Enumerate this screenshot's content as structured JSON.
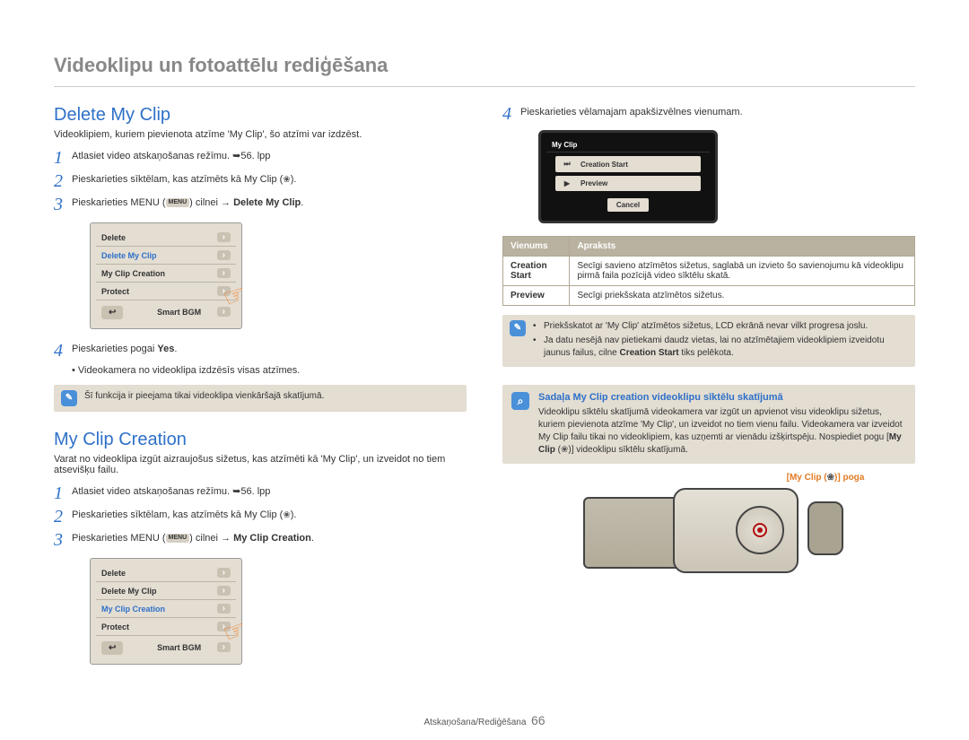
{
  "page_title": "Videoklipu un fotoattēlu rediģēšana",
  "footer": {
    "section": "Atskaņošana/Rediģēšana",
    "page": "66"
  },
  "left": {
    "delete": {
      "heading": "Delete My Clip",
      "intro": "Videoklipiem, kuriem pievienota atzīme 'My Clip', šo atzīmi var izdzēst.",
      "steps": {
        "s1": "Atlasiet video atskaņošanas režīmu. ➥56. lpp",
        "s2": "Pieskarieties sīktēlam, kas atzīmēts kā My Clip (",
        "s2_end": ").",
        "s3a": "Pieskarieties MENU (",
        "s3b": ") cilnei → ",
        "s3c": "Delete My Clip",
        "s3d": ".",
        "s4a": "Pieskarieties pogai ",
        "s4b": "Yes",
        "s4sub": "Videokamera no videoklipa izdzēsīs visas atzīmes."
      },
      "menu": {
        "items": [
          "Delete",
          "Delete My Clip",
          "My Clip Creation",
          "Protect",
          "Smart BGM"
        ],
        "highlight_index": 1
      },
      "info": "Šī funkcija ir pieejama tikai videoklipa vienkāršajā skatījumā."
    },
    "creation": {
      "heading": "My Clip Creation",
      "intro": "Varat no videoklipa izgūt aizraujošus sižetus, kas atzīmēti kā 'My Clip', un izveidot no tiem atsevišķu failu.",
      "steps": {
        "s1": "Atlasiet video atskaņošanas režīmu. ➥56. lpp",
        "s2": "Pieskarieties sīktēlam, kas atzīmēts kā My Clip (",
        "s2_end": ").",
        "s3a": "Pieskarieties MENU (",
        "s3b": ") cilnei → ",
        "s3c": "My Clip Creation",
        "s3d": "."
      },
      "menu": {
        "items": [
          "Delete",
          "Delete My Clip",
          "My Clip Creation",
          "Protect",
          "Smart BGM"
        ],
        "highlight_index": 2
      }
    }
  },
  "right": {
    "step4": "Pieskarieties vēlamajam apakšizvēlnes vienumam.",
    "device_menu": {
      "title": "My Clip",
      "rows": [
        {
          "icon": "⏭",
          "label": "Creation Start"
        },
        {
          "icon": "▶",
          "label": "Preview"
        }
      ],
      "cancel": "Cancel"
    },
    "table": {
      "h1": "Vienums",
      "h2": "Apraksts",
      "r1k": "Creation Start",
      "r1v": "Secīgi savieno atzīmētos sižetus, saglabā un izvieto šo savienojumu kā videoklipu pirmā faila pozīcijā video sīktēlu skatā.",
      "r2k": "Preview",
      "r2v": "Secīgi priekšskata atzīmētos sižetus."
    },
    "tips": {
      "t1": "Priekšskatot ar 'My Clip' atzīmētos sižetus, LCD ekrānā nevar vilkt progresa joslu.",
      "t2": "Ja datu nesējā nav pietiekami daudz vietas, lai no atzīmētajiem videoklipiem izveidotu jaunus failus, cilne",
      "t2b": "Creation Start",
      "t2c": " tiks pelēkota."
    },
    "callout": {
      "title": "Sadaļa My Clip creation videoklipu sīktēlu skatījumā",
      "body": "Videoklipu sīktēlu skatījumā videokamera var izgūt un apvienot visu videoklipu sižetus, kuriem pievienota atzīme 'My Clip', un izveidot no tiem vienu failu. Videokamera var izveidot My Clip failu tikai no videoklipiem, kas uzņemti ar vienādu izšķirtspēju. Nospiediet pogu [",
      "body_b": "My Clip",
      "body_c": " (",
      "body_d": ")] videoklipu sīktēlu skatījumā."
    },
    "orange_label": "[My Clip (",
    "orange_label_b": ")] poga"
  }
}
